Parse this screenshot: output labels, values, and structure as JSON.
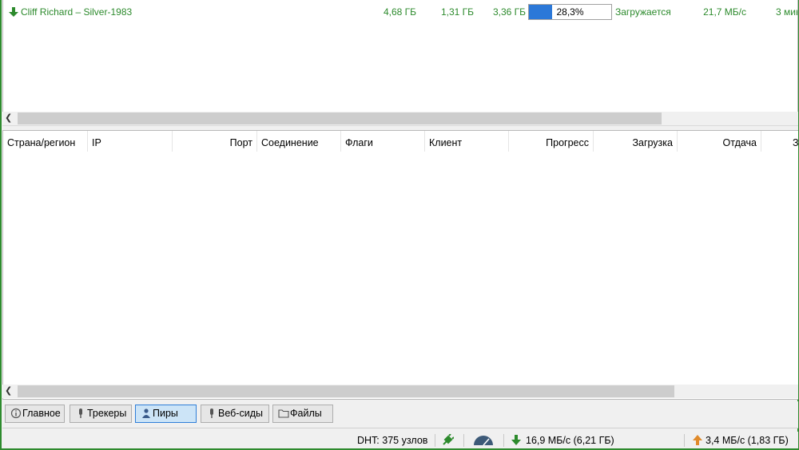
{
  "colors": {
    "status_green": "#2c8a2c",
    "progress_blue": "#2b78d8",
    "tab_active": "#cce4f7"
  },
  "torrent": {
    "icon": "download-arrow-icon",
    "name": "Cliff Richard – Silver-1983",
    "size": "4,68 ГБ",
    "done": "1,31 ГБ",
    "remaining": "3,36 ГБ",
    "progress_text": "28,3%",
    "progress_fraction": 0.283,
    "status": "Загружается",
    "down_speed": "21,7 МБ/с",
    "eta": "3 мин"
  },
  "peers": {
    "columns": [
      "Страна/регион",
      "IP",
      "Порт",
      "Соединение",
      "Флаги",
      "Клиент",
      "Прогресс",
      "Загрузка",
      "Отдача",
      "З"
    ]
  },
  "tabs": [
    {
      "label": "Главное",
      "icon": "info-icon",
      "active": false
    },
    {
      "label": "Трекеры",
      "icon": "tracker-icon",
      "active": false
    },
    {
      "label": "Пиры",
      "icon": "peers-icon",
      "active": true
    },
    {
      "label": "Веб-сиды",
      "icon": "web-seed-icon",
      "active": false
    },
    {
      "label": "Файлы",
      "icon": "folder-icon",
      "active": false
    }
  ],
  "status": {
    "dht": "DHT: 375 узлов",
    "download": "16,9 МБ/с (6,21 ГБ)",
    "upload": "3,4 МБ/с (1,83 ГБ)"
  }
}
